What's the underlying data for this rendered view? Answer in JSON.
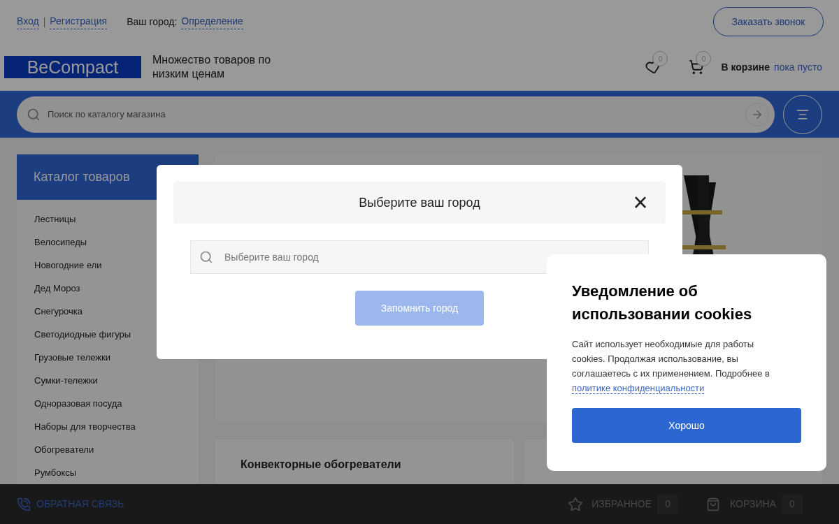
{
  "header": {
    "login": "Вход",
    "separator": "|",
    "register": "Регистрация",
    "city_label": "Ваш город:",
    "city_value": "Определение",
    "callback_button": "Заказать звонок"
  },
  "brand": {
    "logo": "BeCompact",
    "tagline": "Множество товаров по низким ценам"
  },
  "header_icons": {
    "favorites_count": "0",
    "cart_count": "0",
    "cart_label": "В корзине",
    "cart_status": "пока пусто"
  },
  "search": {
    "placeholder": "Поиск по каталогу магазина"
  },
  "catalog": {
    "title": "Каталог товаров",
    "items": [
      "Лестницы",
      "Велосипеды",
      "Новогодние ели",
      "Дед Мороз",
      "Снегурочка",
      "Светодиодные фигуры",
      "Грузовые тележки",
      "Сумки-тележки",
      "Одноразовая посуда",
      "Наборы для творчества",
      "Обогреватели",
      "Румбоксы"
    ]
  },
  "cards": [
    {
      "title": "Конвекторные обогреватели"
    }
  ],
  "city_dialog": {
    "title": "Выберите ваш город",
    "close": "×",
    "placeholder": "Выберите ваш город",
    "button": "Запомнить город",
    "button_disabled": true
  },
  "cookie_notice": {
    "title": "Уведомление об использовании cookies",
    "text": "Сайт использует необходимые для работы cookies. Продолжая использование, вы соглашаетесь с их применением. Подробнее в",
    "link": "политике конфиденциальности",
    "button": "Хорошо"
  },
  "bottom_bar": {
    "feedback": "ОБРАТНАЯ СВЯЗЬ",
    "favorites": "ИЗБРАННОЕ",
    "favorites_count": "0",
    "cart": "КОРЗИНА",
    "cart_count": "0"
  }
}
